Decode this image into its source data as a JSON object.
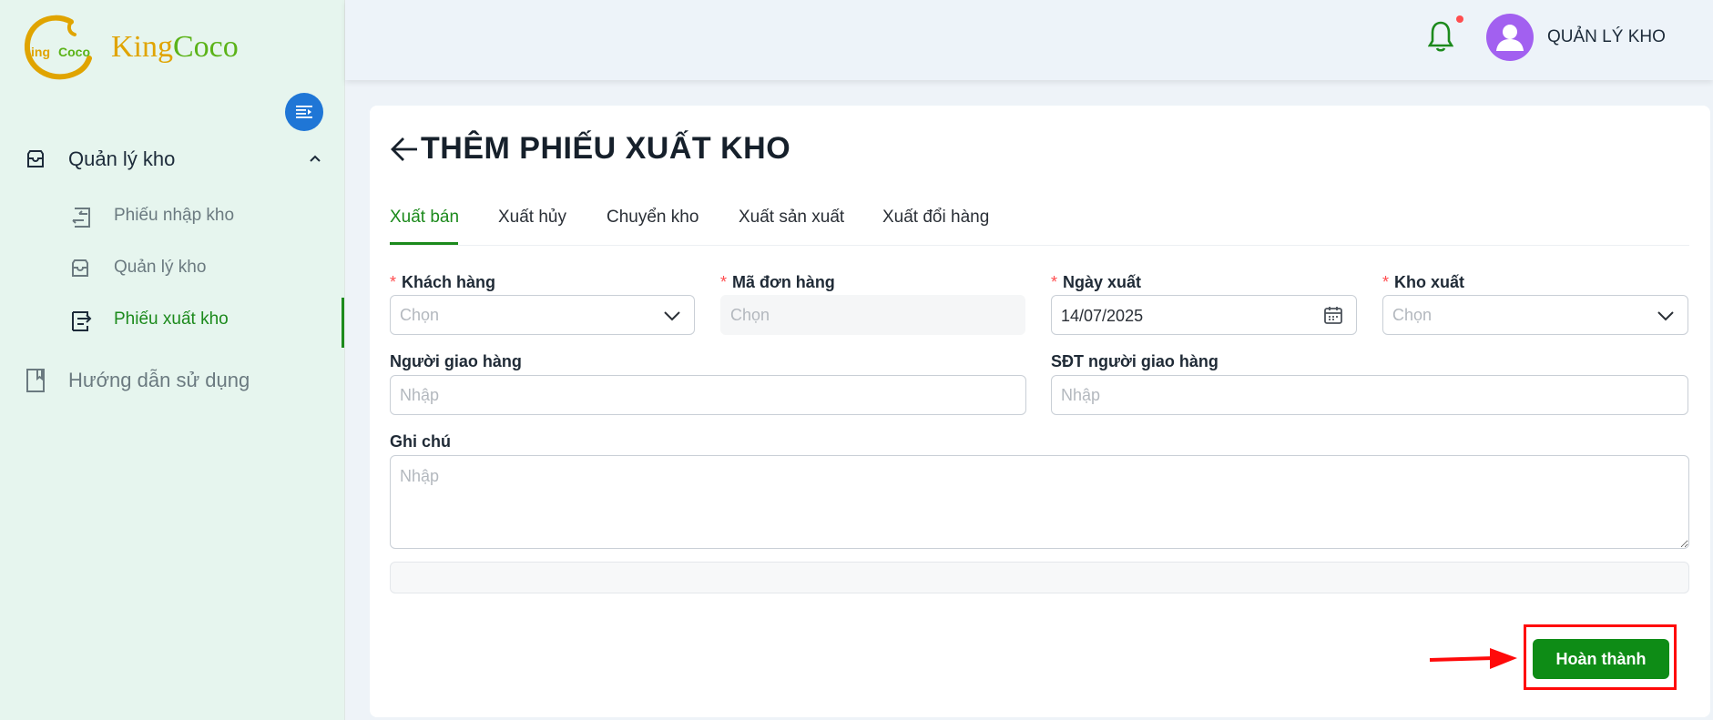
{
  "app": {
    "logo_text_k": "King",
    "logo_text_c": "Coco",
    "brand_colors": {
      "primary": "#1c8a1c",
      "accent_blue": "#1f76d6",
      "logo_yellow": "#e0a400",
      "logo_green": "#5bb318"
    }
  },
  "sidebar": {
    "group_label": "Quản lý kho",
    "items": [
      {
        "label": "Phiếu nhập kho",
        "icon": "arrows-swap-icon",
        "active": false
      },
      {
        "label": "Quản lý kho",
        "icon": "inbox-icon",
        "active": false
      },
      {
        "label": "Phiếu xuất kho",
        "icon": "export-list-icon",
        "active": true
      }
    ],
    "guide_label": "Hướng dẫn sử dụng"
  },
  "header": {
    "username": "QUẢN LÝ KHO",
    "has_notification": true
  },
  "page": {
    "title": "THÊM PHIẾU XUẤT KHO",
    "tabs": [
      {
        "label": "Xuất bán",
        "active": true
      },
      {
        "label": "Xuất hủy",
        "active": false
      },
      {
        "label": "Chuyển kho",
        "active": false
      },
      {
        "label": "Xuất sản xuất",
        "active": false
      },
      {
        "label": "Xuất đổi hàng",
        "active": false
      }
    ]
  },
  "form": {
    "required_mark": "*",
    "customer": {
      "label": "Khách hàng",
      "placeholder": "Chọn"
    },
    "order_code": {
      "label": "Mã đơn hàng",
      "placeholder": "Chọn"
    },
    "export_date": {
      "label": "Ngày xuất",
      "value": "14/07/2025"
    },
    "warehouse": {
      "label": "Kho xuất",
      "placeholder": "Chọn"
    },
    "shipper": {
      "label": "Người giao hàng",
      "placeholder": "Nhập"
    },
    "shipper_phone": {
      "label": "SĐT người giao hàng",
      "placeholder": "Nhập"
    },
    "note": {
      "label": "Ghi chú",
      "placeholder": "Nhập"
    },
    "submit_label": "Hoàn thành"
  }
}
